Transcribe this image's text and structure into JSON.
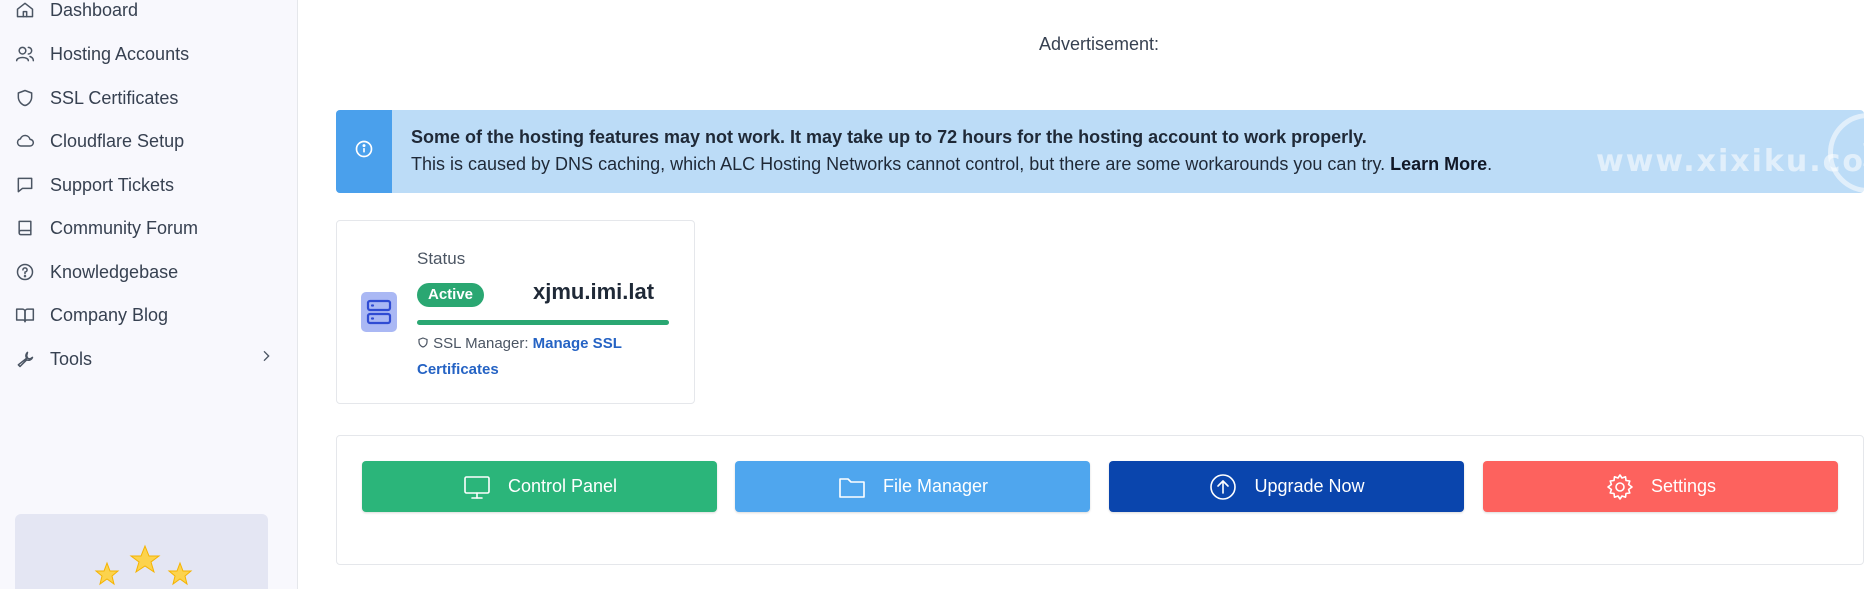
{
  "sidebar": {
    "items": [
      {
        "label": "Dashboard",
        "icon": "home-icon"
      },
      {
        "label": "Hosting Accounts",
        "icon": "users-icon"
      },
      {
        "label": "SSL Certificates",
        "icon": "shield-icon"
      },
      {
        "label": "Cloudflare Setup",
        "icon": "cloud-icon"
      },
      {
        "label": "Support Tickets",
        "icon": "chat-icon"
      },
      {
        "label": "Community Forum",
        "icon": "book-icon"
      },
      {
        "label": "Knowledgebase",
        "icon": "question-icon"
      },
      {
        "label": "Company Blog",
        "icon": "open-book-icon"
      },
      {
        "label": "Tools",
        "icon": "wrench-icon"
      }
    ]
  },
  "main": {
    "advertisement_label": "Advertisement:",
    "alert": {
      "title": "Some of the hosting features may not work. It may take up to 72 hours for the hosting account to work properly.",
      "body": "This is caused by DNS caching, which ALC Hosting Networks cannot control, but there are some workarounds you can try. ",
      "link": "Learn More",
      "period": ".",
      "watermark": "www.xixiku.com",
      "watermark_glyph": "i",
      "color": "#bcdcf7",
      "accent": "#4aa0ec"
    },
    "status": {
      "label": "Status",
      "badge": "Active",
      "domain": "xjmu.imi.lat",
      "progress": 1.0,
      "ssl_prefix": "SSL Manager: ",
      "ssl_link": "Manage SSL Certificates",
      "badge_color": "#2aa772"
    },
    "actions": [
      {
        "label": "Control Panel",
        "icon": "monitor-icon",
        "color": "#2bb57a"
      },
      {
        "label": "File Manager",
        "icon": "folder-icon",
        "color": "#4fa6ee"
      },
      {
        "label": "Upgrade Now",
        "icon": "upload-circle-icon",
        "color": "#0a45ad"
      },
      {
        "label": "Settings",
        "icon": "gear-icon",
        "color": "#fd625e"
      }
    ]
  }
}
